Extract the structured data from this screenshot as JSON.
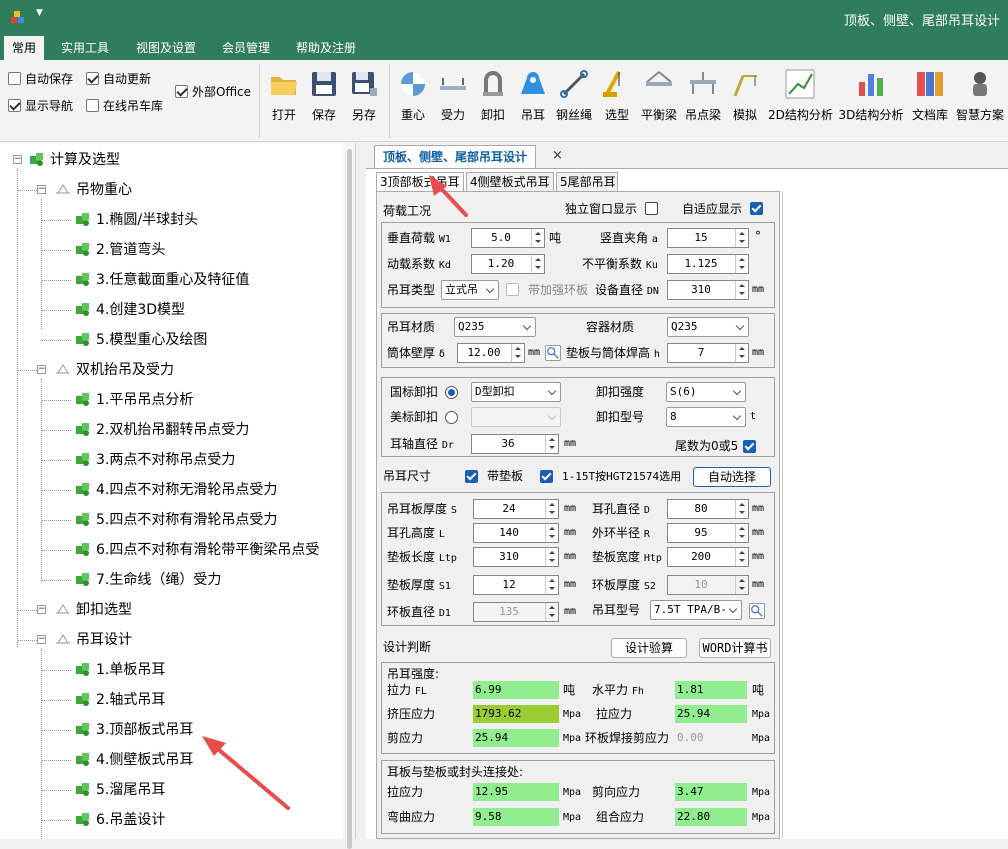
{
  "window": {
    "title": "顶板、侧壁、尾部吊耳设计"
  },
  "menu": [
    "常用",
    "实用工具",
    "视图及设置",
    "会员管理",
    "帮助及注册"
  ],
  "ribbon": {
    "checks": [
      {
        "label": "自动保存",
        "checked": false
      },
      {
        "label": "自动更新",
        "checked": true
      },
      {
        "label": "显示导航",
        "checked": true
      },
      {
        "label": "在线吊车库",
        "checked": false
      },
      {
        "label": "外部Office",
        "checked": true
      }
    ],
    "file_buttons": [
      "打开",
      "保存",
      "另存"
    ],
    "tool_buttons": [
      "重心",
      "受力",
      "卸扣",
      "吊耳",
      "钢丝绳",
      "选型",
      "平衡梁",
      "吊点梁",
      "模拟",
      "2D结构分析",
      "3D结构分析",
      "文档库",
      "智慧方案"
    ]
  },
  "tree": [
    {
      "label": "计算及选型",
      "level": 0
    },
    {
      "label": "吊物重心",
      "level": 1
    },
    {
      "label": "1.椭圆/半球封头",
      "level": 2
    },
    {
      "label": "2.管道弯头",
      "level": 2
    },
    {
      "label": "3.任意截面重心及特征值",
      "level": 2
    },
    {
      "label": "4.创建3D模型",
      "level": 2
    },
    {
      "label": "5.模型重心及绘图",
      "level": 2
    },
    {
      "label": "双机抬吊及受力",
      "level": 1
    },
    {
      "label": "1.平吊吊点分析",
      "level": 2
    },
    {
      "label": "2.双机抬吊翻转吊点受力",
      "level": 2
    },
    {
      "label": "3.两点不对称吊点受力",
      "level": 2
    },
    {
      "label": "4.四点不对称无滑轮吊点受力",
      "level": 2
    },
    {
      "label": "5.四点不对称有滑轮吊点受力",
      "level": 2
    },
    {
      "label": "6.四点不对称有滑轮带平衡梁吊点受",
      "level": 2
    },
    {
      "label": "7.生命线（绳）受力",
      "level": 2
    },
    {
      "label": "卸扣选型",
      "level": 1
    },
    {
      "label": "吊耳设计",
      "level": 1
    },
    {
      "label": "1.单板吊耳",
      "level": 2
    },
    {
      "label": "2.轴式吊耳",
      "level": 2
    },
    {
      "label": "3.顶部板式吊耳",
      "level": 2
    },
    {
      "label": "4.侧壁板式吊耳",
      "level": 2
    },
    {
      "label": "5.溜尾吊耳",
      "level": 2
    },
    {
      "label": "6.吊盖设计",
      "level": 2
    }
  ],
  "doc_tab": "顶板、侧壁、尾部吊耳设计",
  "doc_tab_close": "×",
  "subtabs": [
    "3顶部板式吊耳",
    "4侧壁板式吊耳",
    "5尾部吊耳"
  ],
  "load": {
    "title": "荷载工况",
    "standalone_label": "独立窗口显示",
    "adaptive_label": "自适应显示",
    "vload_label": "垂直荷载",
    "vload_sym": "W1",
    "vload_value": "5.0",
    "vload_unit": "吨",
    "angle_label": "竖直夹角",
    "angle_sym": "a",
    "angle_value": "15",
    "angle_unit": "°",
    "kd_label": "动载系数",
    "kd_sym": "Kd",
    "kd_value": "1.20",
    "ku_label": "不平衡系数",
    "ku_sym": "Ku",
    "ku_value": "1.125",
    "type_label": "吊耳类型",
    "type_value": "立式吊",
    "ring_label": "带加强环板",
    "dn_label": "设备直径",
    "dn_sym": "DN",
    "dn_value": "310",
    "dn_unit": "mm"
  },
  "material": {
    "lug_label": "吊耳材质",
    "lug_value": "Q235",
    "vessel_label": "容器材质",
    "vessel_value": "Q235",
    "wall_label": "筒体壁厚",
    "wall_sym": "δ",
    "wall_value": "12.00",
    "wall_unit": "mm",
    "weld_label": "垫板与筒体焊高",
    "weld_sym": "h",
    "weld_value": "7",
    "weld_unit": "mm"
  },
  "shackle": {
    "gb_label": "国标卸扣",
    "gb_type": "D型卸扣",
    "strength_label": "卸扣强度",
    "strength_value": "S(6)",
    "us_label": "美标卸扣",
    "us_type": "",
    "model_label": "卸扣型号",
    "model_value": "8",
    "model_unit": "t",
    "pin_label": "耳轴直径",
    "pin_sym": "Dr",
    "pin_value": "36",
    "pin_unit": "mm",
    "tail_label": "尾数为0或5"
  },
  "dims": {
    "title": "吊耳尺寸",
    "pad_label": "带垫板",
    "std_label": "1-15T按HGT21574选用",
    "auto_button": "自动选择",
    "rows": [
      {
        "l": "吊耳板厚度",
        "s": "S",
        "v": "24",
        "u": "mm",
        "l2": "耳孔直径",
        "s2": "D",
        "v2": "80",
        "u2": "mm"
      },
      {
        "l": "耳孔高度",
        "s": "L",
        "v": "140",
        "u": "mm",
        "l2": "外环半径",
        "s2": "R",
        "v2": "95",
        "u2": "mm"
      },
      {
        "l": "垫板长度",
        "s": "Ltp",
        "v": "310",
        "u": "mm",
        "l2": "垫板宽度",
        "s2": "Htp",
        "v2": "200",
        "u2": "mm"
      },
      {
        "l": "垫板厚度",
        "s": "S1",
        "v": "12",
        "u": "mm",
        "l2": "环板厚度",
        "s2": "S2",
        "v2": "10",
        "u2": "mm"
      }
    ],
    "ring_dia_label": "环板直径",
    "ring_dia_sym": "D1",
    "ring_dia_value": "135",
    "ring_dia_unit": "mm",
    "lug_model_label": "吊耳型号",
    "lug_model_value": "7.5T TPA/B-"
  },
  "design": {
    "title": "设计判断",
    "check_button": "设计验算",
    "word_button": "WORD计算书",
    "strength_title": "吊耳强度:",
    "pull_label": "拉力",
    "pull_sym": "FL",
    "pull_value": "6.99",
    "pull_unit": "吨",
    "horiz_label": "水平力",
    "horiz_sym": "Fh",
    "horiz_value": "1.81",
    "horiz_unit": "吨",
    "bearing_label": "挤压应力",
    "bearing_value": "1793.62",
    "bearing_unit": "Mpa",
    "tensile_label": "拉应力",
    "tensile_value": "25.94",
    "tensile_unit": "Mpa",
    "shear_label": "剪应力",
    "shear_value": "25.94",
    "shear_unit": "Mpa",
    "ringweld_label": "环板焊接剪应力",
    "ringweld_value": "0.00",
    "ringweld_unit": "Mpa",
    "joint_title": "耳板与垫板或封头连接处:",
    "j_tensile_label": "拉应力",
    "j_tensile_value": "12.95",
    "j_tensile_unit": "Mpa",
    "j_shear_label": "剪向应力",
    "j_shear_value": "3.47",
    "j_shear_unit": "Mpa",
    "j_bend_label": "弯曲应力",
    "j_bend_value": "9.58",
    "j_bend_unit": "Mpa",
    "j_comb_label": "组合应力",
    "j_comb_value": "22.80",
    "j_comb_unit": "Mpa"
  },
  "colors": {
    "title_bar": "#2f7d5a",
    "accent_blue": "#1a5fb4",
    "result_green": "#90ee90",
    "result_warn": "#9acd32",
    "annotation_red": "#e84c4c"
  }
}
